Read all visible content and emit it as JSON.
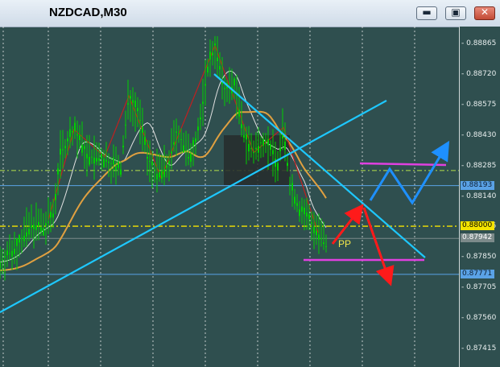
{
  "window": {
    "title": "NZDCAD,M30",
    "buttons": {
      "minimize": "▬",
      "restore": "▣",
      "close": "✕"
    }
  },
  "chart_data": {
    "type": "candlestick",
    "symbol": "NZDCAD",
    "timeframe": "M30",
    "ylim": [
      0.8733,
      0.8895
    ],
    "price_ticks": [
      "0.88865",
      "0.88720",
      "0.88575",
      "0.88430",
      "0.88285",
      "0.88140",
      "0.87995",
      "0.87850",
      "0.87705",
      "0.87560",
      "0.87415"
    ],
    "levels": [
      {
        "label": "0.88193",
        "value": 0.88193,
        "color": "#5aa2e6",
        "style": "solid"
      },
      {
        "label": "0.88000",
        "value": 0.88,
        "color": "#f5e400",
        "style": "dashdot"
      },
      {
        "label": "0.87942",
        "value": 0.87942,
        "color": "#7c8a8a",
        "style": "solid"
      },
      {
        "label": "0.87771",
        "value": 0.87771,
        "color": "#5aa2e6",
        "style": "solid"
      }
    ],
    "annotations": {
      "pivot_label": "PP"
    },
    "colors": {
      "background": "#2f4f4f",
      "candles": "#00d000",
      "trendlines": "#1ec8ff",
      "zones": "#e040e0",
      "bull_arrows": "#1e90ff",
      "bear_arrows": "#ff1a1a",
      "ma_fast": "#e0e0e0",
      "ma_slow": "#e0a040",
      "ma_red": "#c02020"
    }
  }
}
